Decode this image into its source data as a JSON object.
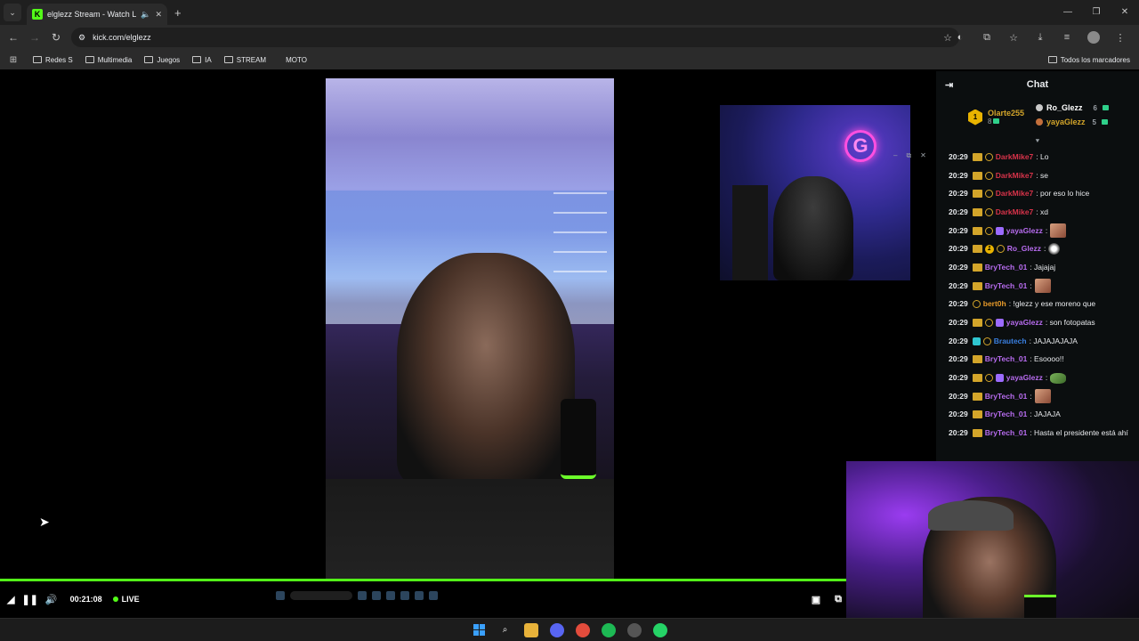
{
  "browser": {
    "tab_title": "elglezz Stream - Watch Live",
    "url": "kick.com/elglezz",
    "bookmarks": [
      "Redes S",
      "Multimedia",
      "Juegos",
      "IA",
      "STREAM",
      "MOTO"
    ],
    "bookmarks_right": "Todos los marcadores"
  },
  "player": {
    "elapsed": "00:21:08",
    "live_label": "LIVE",
    "accent_color": "#53fc18"
  },
  "chat": {
    "title": "Chat",
    "podium": {
      "first": {
        "rank": "1",
        "name": "Olarte255",
        "count": "8"
      },
      "second": {
        "name": "Ro_Glezz",
        "count": "6"
      },
      "third": {
        "name": "yayaGlezz",
        "count": "5"
      }
    },
    "messages": [
      {
        "time": "20:29",
        "user": "DarkMike7",
        "text": ": Lo",
        "color": "#d8334a"
      },
      {
        "time": "20:29",
        "user": "DarkMike7",
        "text": ": se",
        "color": "#d8334a"
      },
      {
        "time": "20:29",
        "user": "DarkMike7",
        "text": ": por eso lo hice",
        "color": "#d8334a"
      },
      {
        "time": "20:29",
        "user": "DarkMike7",
        "text": ": xd",
        "color": "#d8334a"
      },
      {
        "time": "20:29",
        "user": "yayaGlezz",
        "text": ":",
        "color": "#b86cf0"
      },
      {
        "time": "20:29",
        "user": "Ro_Glezz",
        "text": ":",
        "color": "#b86cf0"
      },
      {
        "time": "20:29",
        "user": "BryTech_01",
        "text": ": Jajajaj",
        "color": "#b86cf0"
      },
      {
        "time": "20:29",
        "user": "BryTech_01",
        "text": ":",
        "color": "#b86cf0"
      },
      {
        "time": "20:29",
        "user": "bert0h",
        "text": ": !glezz y ese moreno que",
        "color": "#e89b2a"
      },
      {
        "time": "20:29",
        "user": "yayaGlezz",
        "text": ": son fotopatas",
        "color": "#b86cf0"
      },
      {
        "time": "20:29",
        "user": "Brautech",
        "text": ": JAJAJAJAJA",
        "color": "#3a7fe0"
      },
      {
        "time": "20:29",
        "user": "BryTech_01",
        "text": ": Esoooo!!",
        "color": "#b86cf0"
      },
      {
        "time": "20:29",
        "user": "yayaGlezz",
        "text": ":",
        "color": "#b86cf0"
      },
      {
        "time": "20:29",
        "user": "BryTech_01",
        "text": ":",
        "color": "#b86cf0"
      },
      {
        "time": "20:29",
        "user": "BryTech_01",
        "text": ": JAJAJA",
        "color": "#b86cf0"
      },
      {
        "time": "20:29",
        "user": "BryTech_01",
        "text": ": Hasta el presidente está ahí",
        "color": "#b86cf0"
      }
    ]
  }
}
